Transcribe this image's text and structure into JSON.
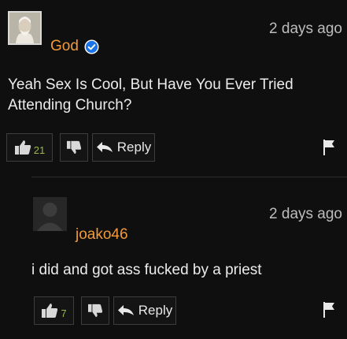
{
  "comments": [
    {
      "username": "God",
      "verified": true,
      "time": "2 days ago",
      "text": "Yeah Sex Is Cool, But Have You Ever Tried Attending Church?",
      "likes": "21",
      "reply_label": "Reply"
    },
    {
      "username": "joako46",
      "verified": false,
      "time": "2 days ago",
      "text": "i did and got ass fucked by a priest",
      "likes": "7",
      "reply_label": "Reply"
    }
  ],
  "colors": {
    "background": "#0f0f0f",
    "username": "#f19a3a",
    "like_count": "#9bb84a",
    "verified": "#1a73e8"
  },
  "icons": [
    "thumbs-up-icon",
    "thumbs-down-icon",
    "reply-arrow-icon",
    "flag-icon",
    "verified-badge-icon"
  ]
}
